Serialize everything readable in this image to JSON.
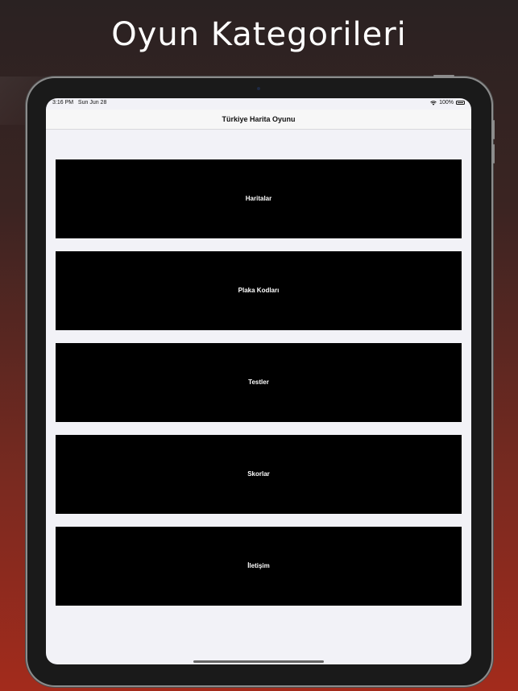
{
  "headline": "Oyun Kategorileri",
  "status_bar": {
    "time": "3:16 PM",
    "date": "Sun Jun 28",
    "battery": "100%",
    "icons": [
      "wifi-icon",
      "battery-icon"
    ]
  },
  "nav": {
    "title": "Türkiye Harita Oyunu"
  },
  "menu": {
    "items": [
      {
        "label": "Haritalar"
      },
      {
        "label": "Plaka Kodları"
      },
      {
        "label": "Testler"
      },
      {
        "label": "Skorlar"
      },
      {
        "label": "İletişim"
      }
    ]
  },
  "colors": {
    "button_bg": "#000000",
    "button_text": "#ffffff",
    "screen_bg": "#f2f2f7",
    "bg_top": "#2a2222",
    "bg_bottom": "#a32b1c"
  }
}
